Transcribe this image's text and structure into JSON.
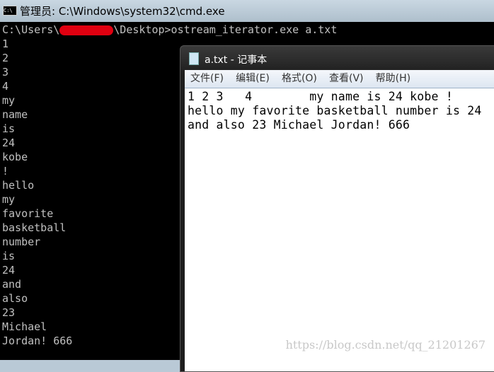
{
  "cmd": {
    "title": "管理员: C:\\Windows\\system32\\cmd.exe",
    "prompt_prefix": "C:\\Users\\",
    "prompt_suffix": "\\Desktop>ostream_iterator.exe a.txt",
    "output": [
      "1",
      "2",
      "3",
      "4",
      "my",
      "name",
      "is",
      "24",
      "kobe",
      "!",
      "hello",
      "my",
      "favorite",
      "basketball",
      "number",
      "is",
      "24",
      "and",
      "also",
      "23",
      "Michael",
      "Jordan! 666"
    ]
  },
  "notepad": {
    "title": "a.txt - 记事本",
    "menu": [
      "文件(F)",
      "编辑(E)",
      "格式(O)",
      "查看(V)",
      "帮助(H)"
    ],
    "lines": [
      "1 2 3   4        my name is 24 kobe !",
      "hello my favorite basketball number is 24",
      "and also 23 Michael Jordan! 666"
    ]
  },
  "watermark": "https://blog.csdn.net/qq_21201267"
}
